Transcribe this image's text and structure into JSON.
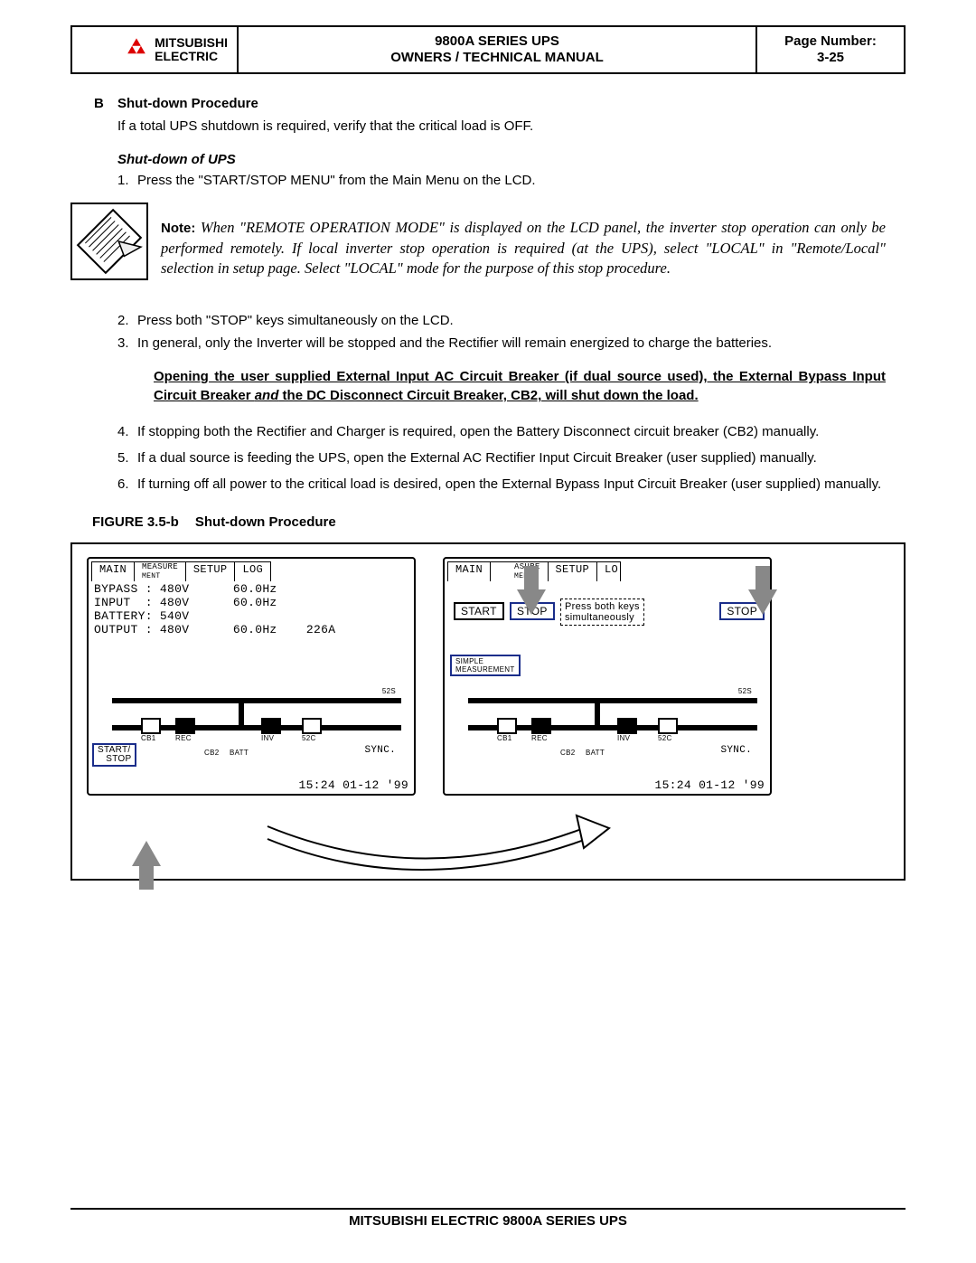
{
  "header": {
    "company_line1": "MITSUBISHI",
    "company_line2": "ELECTRIC",
    "title_line1": "9800A SERIES UPS",
    "title_line2": "OWNERS / TECHNICAL MANUAL",
    "page_label": "Page Number:",
    "page_num": "3-25"
  },
  "section": {
    "letter": "B",
    "title": "Shut-down Procedure",
    "intro": "If a total UPS shutdown is required, verify that the critical load is OFF.",
    "sub_title": "Shut-down of UPS",
    "step1": "Press the \"START/STOP MENU\" from the Main Menu on the LCD.",
    "note_label": "Note:",
    "note_text": "When \"REMOTE OPERATION MODE\" is displayed on the LCD panel, the inverter stop operation can only be performed remotely. If local inverter stop operation is required (at the UPS), select \"LOCAL\" in \"Remote/Local\" selection in setup page. Select \"LOCAL\" mode for the purpose of this stop procedure.",
    "step2": "Press both \"STOP\" keys simultaneously on the LCD.",
    "step3": "In general, only the Inverter will be stopped and the Rectifier will remain energized to charge the batteries.",
    "warn_pre": "Opening the user supplied External Input AC Circuit Breaker (if dual source used), the External Bypass Input Circuit Breaker ",
    "warn_and": "and",
    "warn_post": " the DC Disconnect Circuit Breaker, CB2, will shut down the load.",
    "step4": "If stopping both the Rectifier and Charger is required, open the Battery Disconnect circuit breaker (CB2) manually.",
    "step5": "If a dual source is feeding the UPS, open the External AC Rectifier Input Circuit Breaker (user supplied) manually.",
    "step6": "If turning off all power to the critical load is desired, open the External Bypass Input Circuit Breaker (user supplied) manually.",
    "fig_label": "FIGURE 3.5-b",
    "fig_title": "Shut-down Procedure"
  },
  "lcd": {
    "tabs": [
      "MAIN",
      "MEASURE",
      "SETUP",
      "LOG"
    ],
    "tab_sub": "MENT",
    "tabs2": [
      "MAIN",
      "MEASURE",
      "SETUP",
      "LOG"
    ],
    "rows": {
      "bypass": "BYPASS : 480V      60.0Hz",
      "input": "INPUT  : 480V      60.0Hz",
      "battery": "BATTERY: 540V",
      "output": "OUTPUT : 480V      60.0Hz    226A"
    },
    "btn_start_stop": "START/\n   STOP",
    "sync": "SYNC.",
    "ts": "15:24 01-12 '99",
    "start": "START",
    "stop": "STOP",
    "press_both": "Press both keys\nsimultaneously",
    "simple_meas": "SIMPLE\nMEASUREMENT",
    "cb1": "CB1",
    "rec": "REC",
    "inv": "INV",
    "s2c": "52C",
    "s2s": "52S",
    "cb2": "CB2",
    "batt": "BATT"
  },
  "footer": "MITSUBISHI ELECTRIC 9800A SERIES UPS"
}
